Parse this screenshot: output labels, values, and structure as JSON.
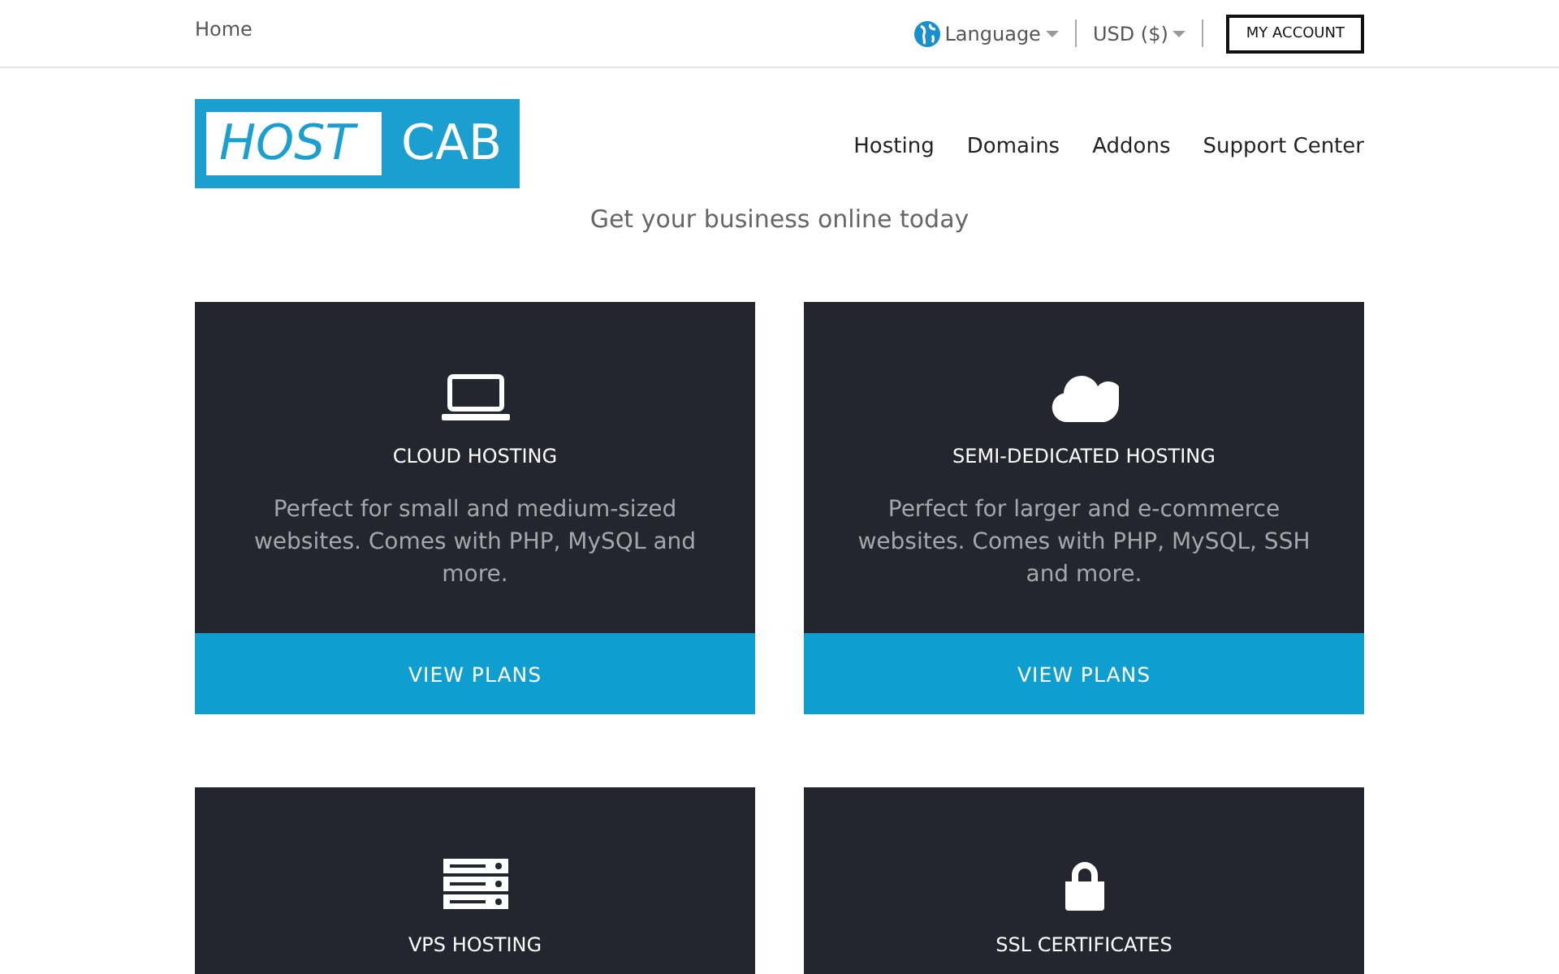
{
  "topbar": {
    "breadcrumb": "Home",
    "language": "Language",
    "currency": "USD ($)",
    "account_button": "MY ACCOUNT"
  },
  "header": {
    "logo": {
      "left": "HOST",
      "right": "CAB"
    },
    "nav": [
      "Hosting",
      "Domains",
      "Addons",
      "Support Center"
    ]
  },
  "tagline": "Get your business online today",
  "cards": [
    {
      "kind": "laptop",
      "title": "CLOUD HOSTING",
      "description": "Perfect for small and medium-sized websites. Comes with PHP, MySQL and more.",
      "button": "VIEW PLANS"
    },
    {
      "kind": "cloud",
      "title": "SEMI-DEDICATED HOSTING",
      "description": "Perfect for larger and e-commerce websites. Comes with PHP, MySQL, SSH and more.",
      "button": "VIEW PLANS"
    },
    {
      "kind": "server",
      "title": "VPS HOSTING"
    },
    {
      "kind": "lock",
      "title": "SSL CERTIFICATES"
    }
  ]
}
